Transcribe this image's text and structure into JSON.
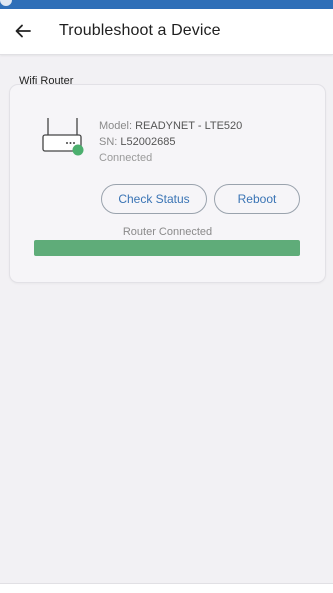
{
  "header": {
    "title": "Troubleshoot a Device",
    "back_icon": "arrow-left-icon"
  },
  "section": {
    "title": "Wifi Router"
  },
  "device": {
    "icon": "router-icon",
    "model_label": "Model:",
    "model_value": "READYNET - LTE520",
    "sn_label": "SN:",
    "sn_value": "L52002685",
    "status": "Connected",
    "status_color": "#4caf6e"
  },
  "actions": {
    "check_status_label": "Check Status",
    "reboot_label": "Reboot"
  },
  "progress": {
    "label": "Router Connected",
    "value": 1.0,
    "color": "#5fac79"
  },
  "colors": {
    "accent": "#2f6fb8",
    "button_text": "#3a74b5"
  }
}
